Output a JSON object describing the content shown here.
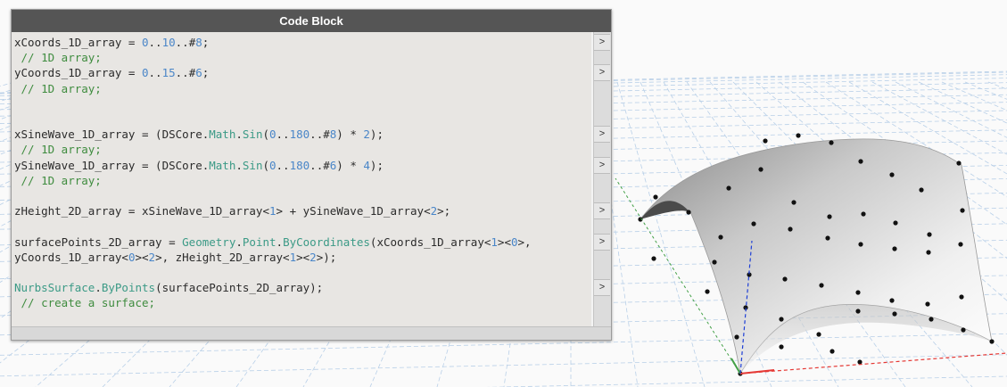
{
  "code_block": {
    "title": "Code Block",
    "lines": [
      {
        "parts": [
          {
            "t": "xCoords_1D_array = ",
            "c": "plain"
          },
          {
            "t": "0",
            "c": "num"
          },
          {
            "t": "..",
            "c": "plain"
          },
          {
            "t": "10",
            "c": "num"
          },
          {
            "t": "..#",
            "c": "plain"
          },
          {
            "t": "8",
            "c": "num"
          },
          {
            "t": ";",
            "c": "plain"
          }
        ]
      },
      {
        "parts": [
          {
            "t": " // 1D array;",
            "c": "cmt"
          }
        ]
      },
      {
        "parts": [
          {
            "t": "yCoords_1D_array = ",
            "c": "plain"
          },
          {
            "t": "0",
            "c": "num"
          },
          {
            "t": "..",
            "c": "plain"
          },
          {
            "t": "15",
            "c": "num"
          },
          {
            "t": "..#",
            "c": "plain"
          },
          {
            "t": "6",
            "c": "num"
          },
          {
            "t": ";",
            "c": "plain"
          }
        ]
      },
      {
        "parts": [
          {
            "t": " // 1D array;",
            "c": "cmt"
          }
        ]
      },
      {
        "parts": [
          {
            "t": "",
            "c": "plain"
          }
        ]
      },
      {
        "parts": [
          {
            "t": "",
            "c": "plain"
          }
        ]
      },
      {
        "parts": [
          {
            "t": "xSineWave_1D_array = (DSCore.",
            "c": "plain"
          },
          {
            "t": "Math",
            "c": "fn"
          },
          {
            "t": ".",
            "c": "plain"
          },
          {
            "t": "Sin",
            "c": "fn"
          },
          {
            "t": "(",
            "c": "plain"
          },
          {
            "t": "0",
            "c": "num"
          },
          {
            "t": "..",
            "c": "plain"
          },
          {
            "t": "180",
            "c": "num"
          },
          {
            "t": "..#",
            "c": "plain"
          },
          {
            "t": "8",
            "c": "num"
          },
          {
            "t": ") * ",
            "c": "plain"
          },
          {
            "t": "2",
            "c": "num"
          },
          {
            "t": ");",
            "c": "plain"
          }
        ]
      },
      {
        "parts": [
          {
            "t": " // 1D array;",
            "c": "cmt"
          }
        ]
      },
      {
        "parts": [
          {
            "t": "ySineWave_1D_array = (DSCore.",
            "c": "plain"
          },
          {
            "t": "Math",
            "c": "fn"
          },
          {
            "t": ".",
            "c": "plain"
          },
          {
            "t": "Sin",
            "c": "fn"
          },
          {
            "t": "(",
            "c": "plain"
          },
          {
            "t": "0",
            "c": "num"
          },
          {
            "t": "..",
            "c": "plain"
          },
          {
            "t": "180",
            "c": "num"
          },
          {
            "t": "..#",
            "c": "plain"
          },
          {
            "t": "6",
            "c": "num"
          },
          {
            "t": ") * ",
            "c": "plain"
          },
          {
            "t": "4",
            "c": "num"
          },
          {
            "t": ");",
            "c": "plain"
          }
        ]
      },
      {
        "parts": [
          {
            "t": " // 1D array;",
            "c": "cmt"
          }
        ]
      },
      {
        "parts": [
          {
            "t": "",
            "c": "plain"
          }
        ]
      },
      {
        "parts": [
          {
            "t": "zHeight_2D_array = xSineWave_1D_array<",
            "c": "plain"
          },
          {
            "t": "1",
            "c": "num"
          },
          {
            "t": "> + ySineWave_1D_array<",
            "c": "plain"
          },
          {
            "t": "2",
            "c": "num"
          },
          {
            "t": ">;",
            "c": "plain"
          }
        ]
      },
      {
        "parts": [
          {
            "t": "",
            "c": "plain"
          }
        ]
      },
      {
        "parts": [
          {
            "t": "surfacePoints_2D_array = ",
            "c": "plain"
          },
          {
            "t": "Geometry",
            "c": "fn"
          },
          {
            "t": ".",
            "c": "plain"
          },
          {
            "t": "Point",
            "c": "fn"
          },
          {
            "t": ".",
            "c": "plain"
          },
          {
            "t": "ByCoordinates",
            "c": "fn"
          },
          {
            "t": "(xCoords_1D_array<",
            "c": "plain"
          },
          {
            "t": "1",
            "c": "num"
          },
          {
            "t": "><",
            "c": "plain"
          },
          {
            "t": "0",
            "c": "num"
          },
          {
            "t": ">,",
            "c": "plain"
          }
        ]
      },
      {
        "parts": [
          {
            "t": "yCoords_1D_array<",
            "c": "plain"
          },
          {
            "t": "0",
            "c": "num"
          },
          {
            "t": "><",
            "c": "plain"
          },
          {
            "t": "2",
            "c": "num"
          },
          {
            "t": ">, zHeight_2D_array<",
            "c": "plain"
          },
          {
            "t": "1",
            "c": "num"
          },
          {
            "t": "><",
            "c": "plain"
          },
          {
            "t": "2",
            "c": "num"
          },
          {
            "t": ">);",
            "c": "plain"
          }
        ]
      },
      {
        "parts": [
          {
            "t": "",
            "c": "plain"
          }
        ]
      },
      {
        "parts": [
          {
            "t": "NurbsSurface",
            "c": "fn"
          },
          {
            "t": ".",
            "c": "plain"
          },
          {
            "t": "ByPoints",
            "c": "fn"
          },
          {
            "t": "(surfacePoints_2D_array);",
            "c": "plain"
          }
        ]
      },
      {
        "parts": [
          {
            "t": " // create a surface;",
            "c": "cmt"
          }
        ]
      }
    ],
    "ports": [
      ">",
      ">",
      ">",
      ">",
      ">",
      ">",
      ">"
    ],
    "colors": {
      "number": "#4a86c8",
      "function": "#3b9a86",
      "comment": "#3f8c3f",
      "header": "#555555"
    }
  },
  "viewport": {
    "axes": {
      "x": "#e53935",
      "y": "#43a047",
      "z": "#1e3fd6"
    }
  }
}
